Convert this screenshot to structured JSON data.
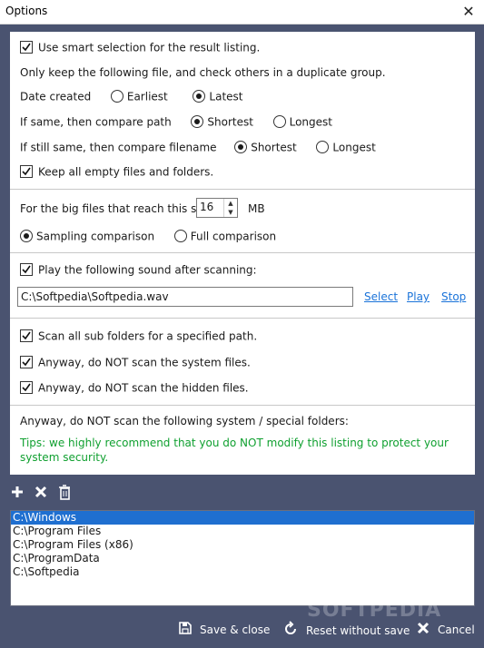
{
  "window": {
    "title": "Options",
    "close_glyph": "✕"
  },
  "smart": {
    "use_smart_label": "Use smart selection for the result listing.",
    "keep_hint": "Only keep the following file, and check others in a duplicate group.",
    "date_label": "Date created",
    "date_options": [
      "Earliest",
      "Latest"
    ],
    "date_selected": "Latest",
    "path_label": "If same, then compare path",
    "path_options": [
      "Shortest",
      "Longest"
    ],
    "path_selected": "Shortest",
    "filename_label": "If still same, then compare filename",
    "filename_options": [
      "Shortest",
      "Longest"
    ],
    "filename_selected": "Shortest",
    "keep_empty_label": "Keep all empty files and folders."
  },
  "bigfiles": {
    "label": "For the big files that reach this size",
    "value": "16",
    "unit": "MB",
    "options": [
      "Sampling comparison",
      "Full comparison"
    ],
    "selected": "Sampling comparison"
  },
  "sound": {
    "label": "Play the following sound after scanning:",
    "path": "C:\\Softpedia\\Softpedia.wav",
    "select": "Select",
    "play": "Play",
    "stop": "Stop"
  },
  "scan": {
    "subfolders": "Scan all sub folders for a specified path.",
    "system_files": "Anyway, do NOT scan the system files.",
    "hidden_files": "Anyway, do NOT scan the hidden files."
  },
  "folders": {
    "label": "Anyway, do NOT scan the following system / special folders:",
    "tips": "Tips: we highly recommend that you do NOT modify this listing to protect your system security.",
    "items": [
      "C:\\Windows",
      "C:\\Program Files",
      "C:\\Program Files (x86)",
      "C:\\ProgramData",
      "C:\\Softpedia"
    ],
    "selected_index": 0
  },
  "footer": {
    "save": "Save & close",
    "reset": "Reset without save",
    "cancel": "Cancel"
  },
  "icons": {
    "add": "plus-icon",
    "remove": "x-icon",
    "delete": "trash-icon",
    "save": "save-icon",
    "reset": "reset-icon",
    "cancel": "cancel-icon"
  },
  "colors": {
    "frame": "#4a5370",
    "link": "#1a73d9",
    "tips": "#10a030",
    "selection": "#1f6fd0"
  },
  "watermark": "SOFTPEDIA"
}
